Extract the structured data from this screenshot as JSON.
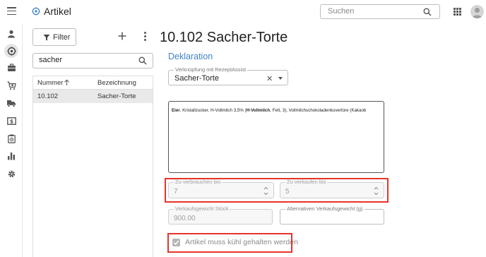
{
  "app": {
    "title": "Artikel",
    "search_placeholder": "Suchen",
    "accent_color": "#3f83c9",
    "highlight_color": "#e5342b"
  },
  "nav": {
    "items": [
      {
        "name": "person-icon"
      },
      {
        "name": "articles-icon",
        "active": true
      },
      {
        "name": "briefcase-icon"
      },
      {
        "name": "cart-icon"
      },
      {
        "name": "truck-icon"
      },
      {
        "name": "money-icon"
      },
      {
        "name": "clipboard-icon"
      },
      {
        "name": "bar-chart-icon"
      },
      {
        "name": "settings-icon"
      }
    ]
  },
  "list": {
    "filter_label": "Filter",
    "search_value": "sacher",
    "columns": [
      "Nummer",
      "Bezeichnung"
    ],
    "rows": [
      {
        "nummer": "10.102",
        "bezeichnung": "Sacher-Torte"
      }
    ]
  },
  "detail": {
    "title": "10.102 Sacher-Torte",
    "section": "Deklaration",
    "rezept_label": "Verknüpfung mit RezeptAssist",
    "rezept_value": "Sacher-Torte",
    "declaration_bold_1": "Eier",
    "declaration_text_1": ", Kristallzucker, H-Vollmilch 3,5% (",
    "declaration_bold_2": "H-Vollmilch",
    "declaration_text_2": ",  Fett, 3), Vollmilchschokoladenkuvertüre (Kakaob",
    "verbrauchen_label": "Zu verbrauchen bis",
    "verbrauchen_value": "7",
    "verkaufen_label": "Zu verkaufen bis",
    "verkaufen_value": "5",
    "gewicht_label": "Verkaufsgewicht Stück",
    "gewicht_value": "900.00",
    "alt_gewicht_label": "Alternativen Verkaufsgewicht (g)",
    "alt_gewicht_value": "",
    "kuehl_label": "Artikel muss kühl gehalten werden",
    "kuehl_checked": true
  }
}
